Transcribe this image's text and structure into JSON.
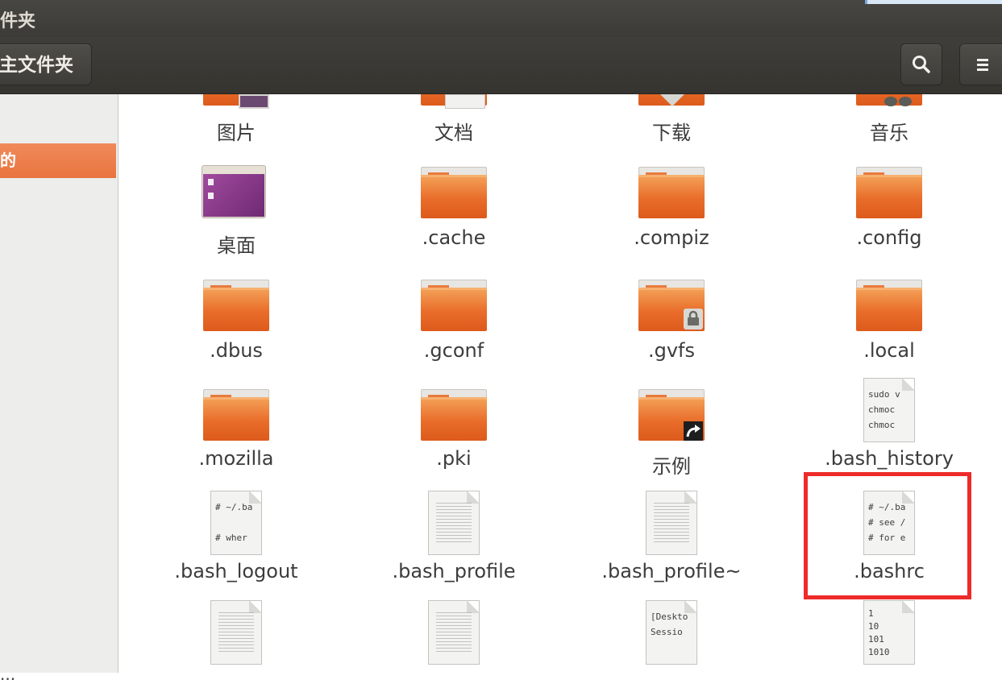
{
  "window": {
    "title": "件夹"
  },
  "toolbar": {
    "path_label": "主文件夹",
    "search_icon": "search-icon",
    "menu_icon": "hamburger-menu-icon"
  },
  "sidebar": {
    "selected_item": "的",
    "bottom_item": "..."
  },
  "files": {
    "pictures": "图片",
    "documents": "文档",
    "downloads": "下载",
    "music": "音乐",
    "desktop": "桌面",
    "cache": ".cache",
    "compiz": ".compiz",
    "config": ".config",
    "dbus": ".dbus",
    "gconf": ".gconf",
    "gvfs": ".gvfs",
    "local": ".local",
    "mozilla": ".mozilla",
    "pki": ".pki",
    "examples": "示例",
    "bash_history": ".bash_history",
    "bash_logout": ".bash_logout",
    "bash_profile": ".bash_profile",
    "bash_profile_backup": ".bash_profile~",
    "bashrc": ".bashrc"
  },
  "previews": {
    "bash_history": "sudo v\nchmoc\nchmoc",
    "bash_logout": "# ~/.ba\n\n# wher",
    "bashrc": "# ~/.ba\n# see /\n# for e",
    "desktop_session": "[Deskto\nSessio",
    "binary": "1\n10\n101\n1010"
  },
  "colors": {
    "accent": "#e9743f",
    "folder": "#e96d2a",
    "highlight": "#ee2a2a",
    "toolbar": "#3c3b37"
  }
}
